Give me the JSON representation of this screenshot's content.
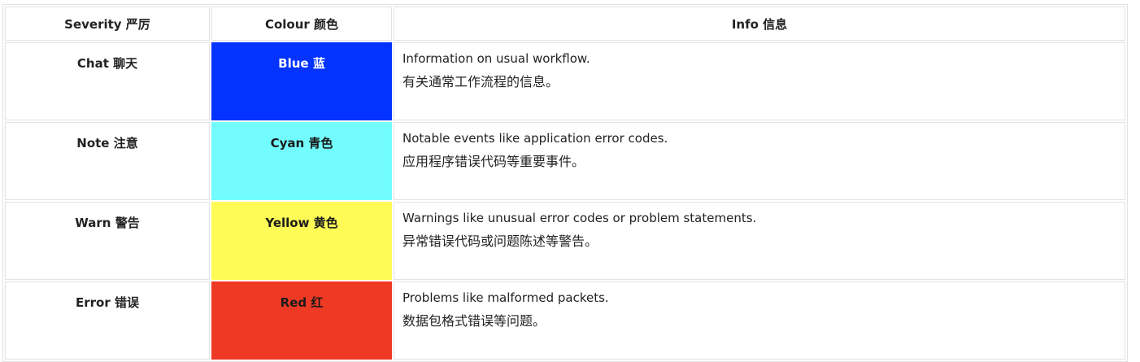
{
  "header": {
    "severity": "Severity 严厉",
    "colour": "Colour 颜色",
    "info": "Info 信息"
  },
  "rows": [
    {
      "severity": "Chat 聊天",
      "colour": "Blue 蓝",
      "colour_hex": "#0433ff",
      "info_en": "Information on usual workflow.",
      "info_zh": "有关通常工作流程的信息。"
    },
    {
      "severity": "Note 注意",
      "colour": "Cyan 青色",
      "colour_hex": "#73fcfd",
      "info_en": "Notable events like application error codes.",
      "info_zh": "应用程序错误代码等重要事件。"
    },
    {
      "severity": "Warn 警告",
      "colour": "Yellow 黄色",
      "colour_hex": "#fffb56",
      "info_en": "Warnings like unusual error codes or problem statements.",
      "info_zh": "异常错误代码或问题陈述等警告。"
    },
    {
      "severity": "Error 错误",
      "colour": "Red 红",
      "colour_hex": "#ee3a24",
      "info_en": "Problems like malformed packets.",
      "info_zh": "数据包格式错误等问题。"
    }
  ]
}
